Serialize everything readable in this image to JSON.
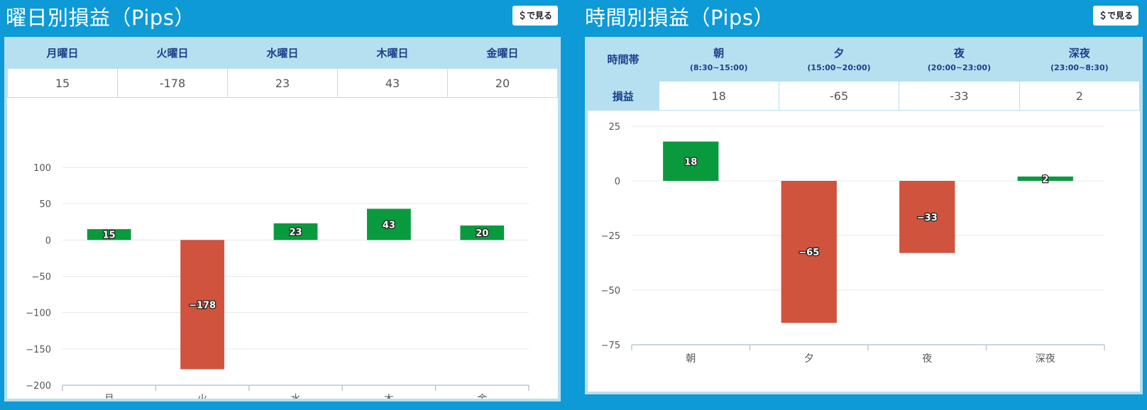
{
  "left": {
    "title": "曜日別損益（Pips）",
    "usd_button": "＄で見る",
    "headers": [
      "月曜日",
      "火曜日",
      "水曜日",
      "木曜日",
      "金曜日"
    ],
    "values": [
      "15",
      "-178",
      "23",
      "43",
      "20"
    ]
  },
  "right": {
    "title": "時間別損益（Pips）",
    "usd_button": "＄で見る",
    "row_label_header": "時間帯",
    "row_label_value": "損益",
    "headers": [
      {
        "name": "朝",
        "range": "(8:30~15:00)"
      },
      {
        "name": "夕",
        "range": "(15:00~20:00)"
      },
      {
        "name": "夜",
        "range": "(20:00~23:00)"
      },
      {
        "name": "深夜",
        "range": "(23:00~8:30)"
      }
    ],
    "values": [
      "18",
      "-65",
      "-33",
      "2"
    ]
  },
  "colors": {
    "positive": "#0a9a3e",
    "negative": "#cf533d",
    "gridline": "#e3e8ec",
    "axis": "#b8c8d8",
    "background": "#0d9ad6",
    "card": "#b6e0f0"
  },
  "chart_data": [
    {
      "type": "bar",
      "categories": [
        "月",
        "火",
        "水",
        "木",
        "金"
      ],
      "values": [
        15,
        -178,
        23,
        43,
        20
      ],
      "ylim": [
        -200,
        100
      ],
      "yticks": [
        100,
        50,
        0,
        -50,
        -100,
        -150,
        -200
      ],
      "ytick_labels": [
        "100",
        "50",
        "0",
        "−50",
        "−100",
        "−150",
        "−200"
      ],
      "data_labels": [
        "15",
        "−178",
        "23",
        "43",
        "20"
      ],
      "grid": true
    },
    {
      "type": "bar",
      "categories": [
        "朝",
        "夕",
        "夜",
        "深夜"
      ],
      "values": [
        18,
        -65,
        -33,
        2
      ],
      "ylim": [
        -75,
        25
      ],
      "yticks": [
        25,
        0,
        -25,
        -50,
        -75
      ],
      "ytick_labels": [
        "25",
        "0",
        "−25",
        "−50",
        "−75"
      ],
      "data_labels": [
        "18",
        "−65",
        "−33",
        "2"
      ],
      "grid": true
    }
  ]
}
